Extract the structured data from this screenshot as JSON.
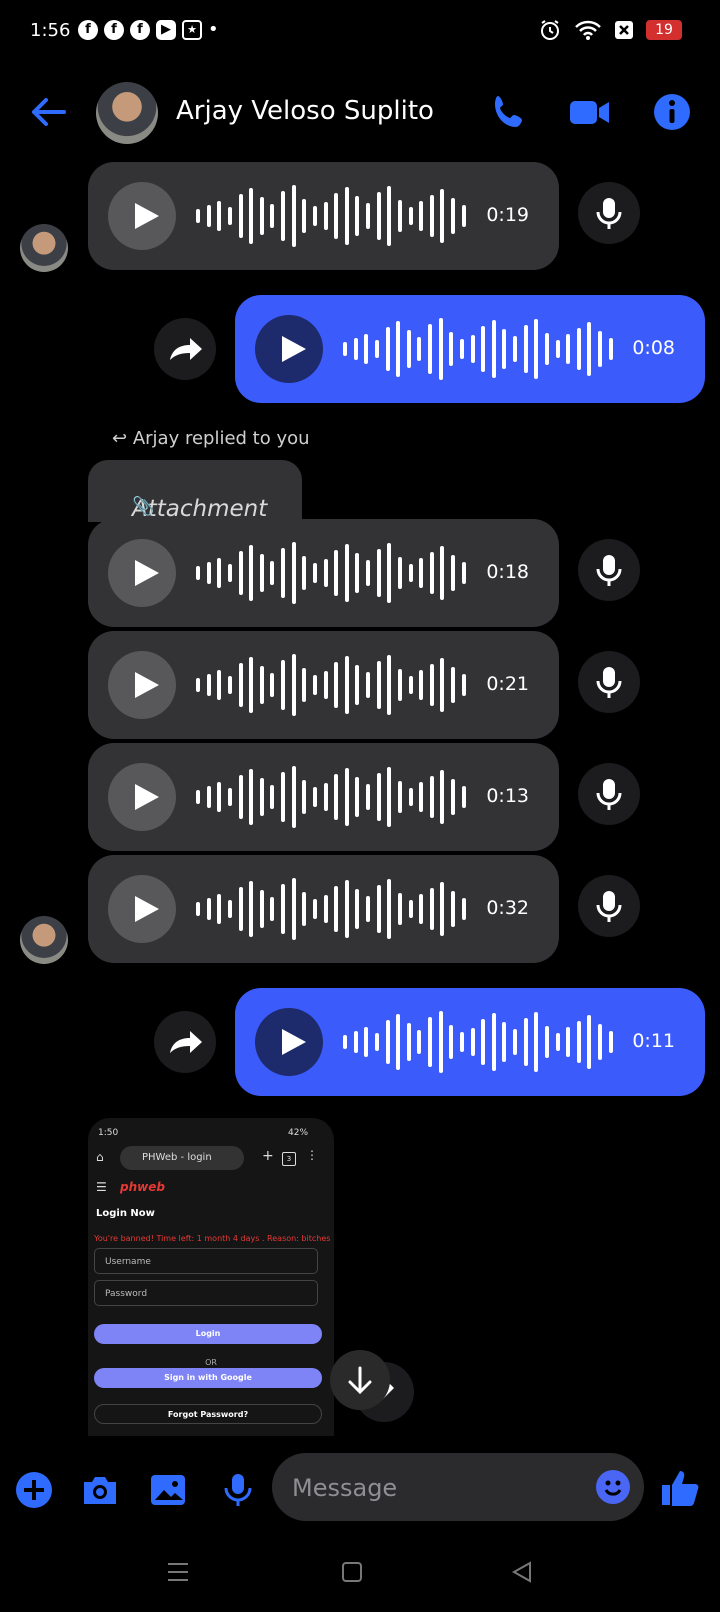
{
  "status_bar": {
    "time": "1:56",
    "notif_icons": [
      "facebook-icon",
      "facebook-icon",
      "facebook-icon",
      "youtube-icon",
      "app-icon"
    ],
    "battery": "19"
  },
  "header": {
    "title": "Arjay Veloso Suplito",
    "accent": "#2f6bff"
  },
  "messages": [
    {
      "type": "voice",
      "from": "them",
      "duration": "0:19"
    },
    {
      "type": "voice",
      "from": "me",
      "duration": "0:08"
    },
    {
      "type": "reply_note",
      "text": "Arjay replied to you"
    },
    {
      "type": "attachment_label",
      "text": "Attachment"
    },
    {
      "type": "voice",
      "from": "them",
      "duration": "0:18"
    },
    {
      "type": "voice",
      "from": "them",
      "duration": "0:21"
    },
    {
      "type": "voice",
      "from": "them",
      "duration": "0:13"
    },
    {
      "type": "voice",
      "from": "them",
      "duration": "0:32"
    },
    {
      "type": "voice",
      "from": "me",
      "duration": "0:11"
    },
    {
      "type": "image",
      "from": "them"
    }
  ],
  "screenshot_thumb": {
    "time": "1:50",
    "battery": "42%",
    "tab_title": "PHWeb - login",
    "tab_count": "3",
    "logo": "phweb",
    "heading": "Login Now",
    "ban_text": "You're banned! Time left: 1 month 4 days . Reason: bitches",
    "username_placeholder": "Username",
    "password_placeholder": "Password",
    "login_label": "Login",
    "or_label": "OR",
    "google_label": "Sign in with Google",
    "forgot_label": "Forgot Password?"
  },
  "composer": {
    "placeholder": "Message"
  }
}
